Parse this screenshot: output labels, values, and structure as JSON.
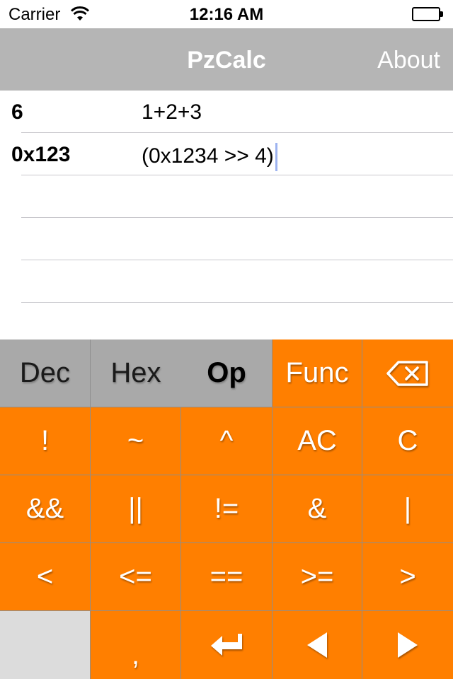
{
  "status_bar": {
    "carrier": "Carrier",
    "time": "12:16 AM"
  },
  "nav": {
    "title": "PzCalc",
    "about": "About"
  },
  "history": [
    {
      "result": "6",
      "expression": "1+2+3"
    },
    {
      "result": "0x123",
      "expression": "(0x1234 >> 4)"
    }
  ],
  "keypad": {
    "modes": {
      "dec": "Dec",
      "hex": "Hex",
      "op": "Op",
      "selected": "Op"
    },
    "func": "Func",
    "row1": [
      "!",
      "~",
      "^",
      "AC",
      "C"
    ],
    "row2": [
      "&&",
      "||",
      "!=",
      "&",
      "|"
    ],
    "row3": [
      "<",
      "<=",
      "==",
      ">=",
      ">"
    ],
    "row4_comma": ",",
    "icons": {
      "backspace": "backspace-icon",
      "enter": "return-icon",
      "left": "arrow-left-icon",
      "right": "arrow-right-icon"
    }
  },
  "colors": {
    "accent": "#ff7f00",
    "nav": "#b5b5b5",
    "mode_keys": "#a9a9a9"
  }
}
